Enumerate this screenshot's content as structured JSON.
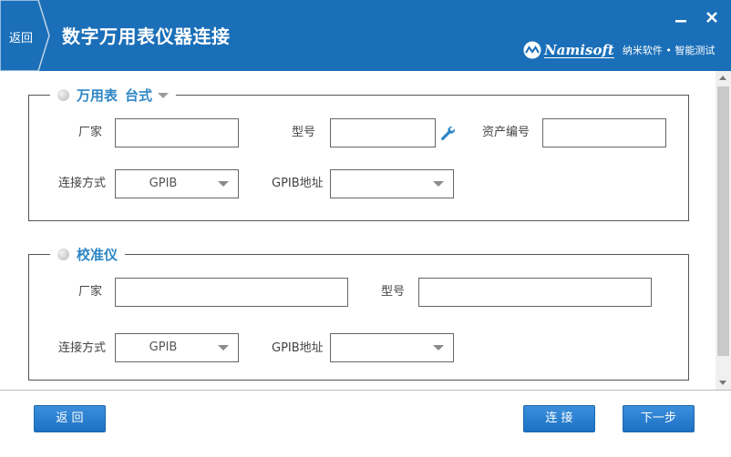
{
  "header": {
    "back_label": "返回",
    "title": "数字万用表仪器连接",
    "brand_name": "Namisoft",
    "brand_sub": "纳米软件 • 智能测试",
    "minimize_icon": "minimize-icon",
    "close_icon": "close-icon"
  },
  "multimeter": {
    "title": "万用表",
    "subtype": "台式",
    "manufacturer_label": "厂家",
    "manufacturer_value": "",
    "model_label": "型号",
    "model_value": "",
    "asset_label": "资产编号",
    "asset_value": "",
    "connection_label": "连接方式",
    "connection_value": "GPIB",
    "address_label": "GPIB地址",
    "address_value": ""
  },
  "calibrator": {
    "title": "校准仪",
    "manufacturer_label": "厂家",
    "manufacturer_value": "",
    "model_label": "型号",
    "model_value": "",
    "connection_label": "连接方式",
    "connection_value": "GPIB",
    "address_label": "GPIB地址",
    "address_value": ""
  },
  "footer": {
    "back_button": "返 回",
    "connect_button": "连 接",
    "next_button": "下一步"
  },
  "colors": {
    "header_bg": "#1b6fb8",
    "accent_text": "#2d86c6",
    "button_bg": "#1c71c4"
  }
}
